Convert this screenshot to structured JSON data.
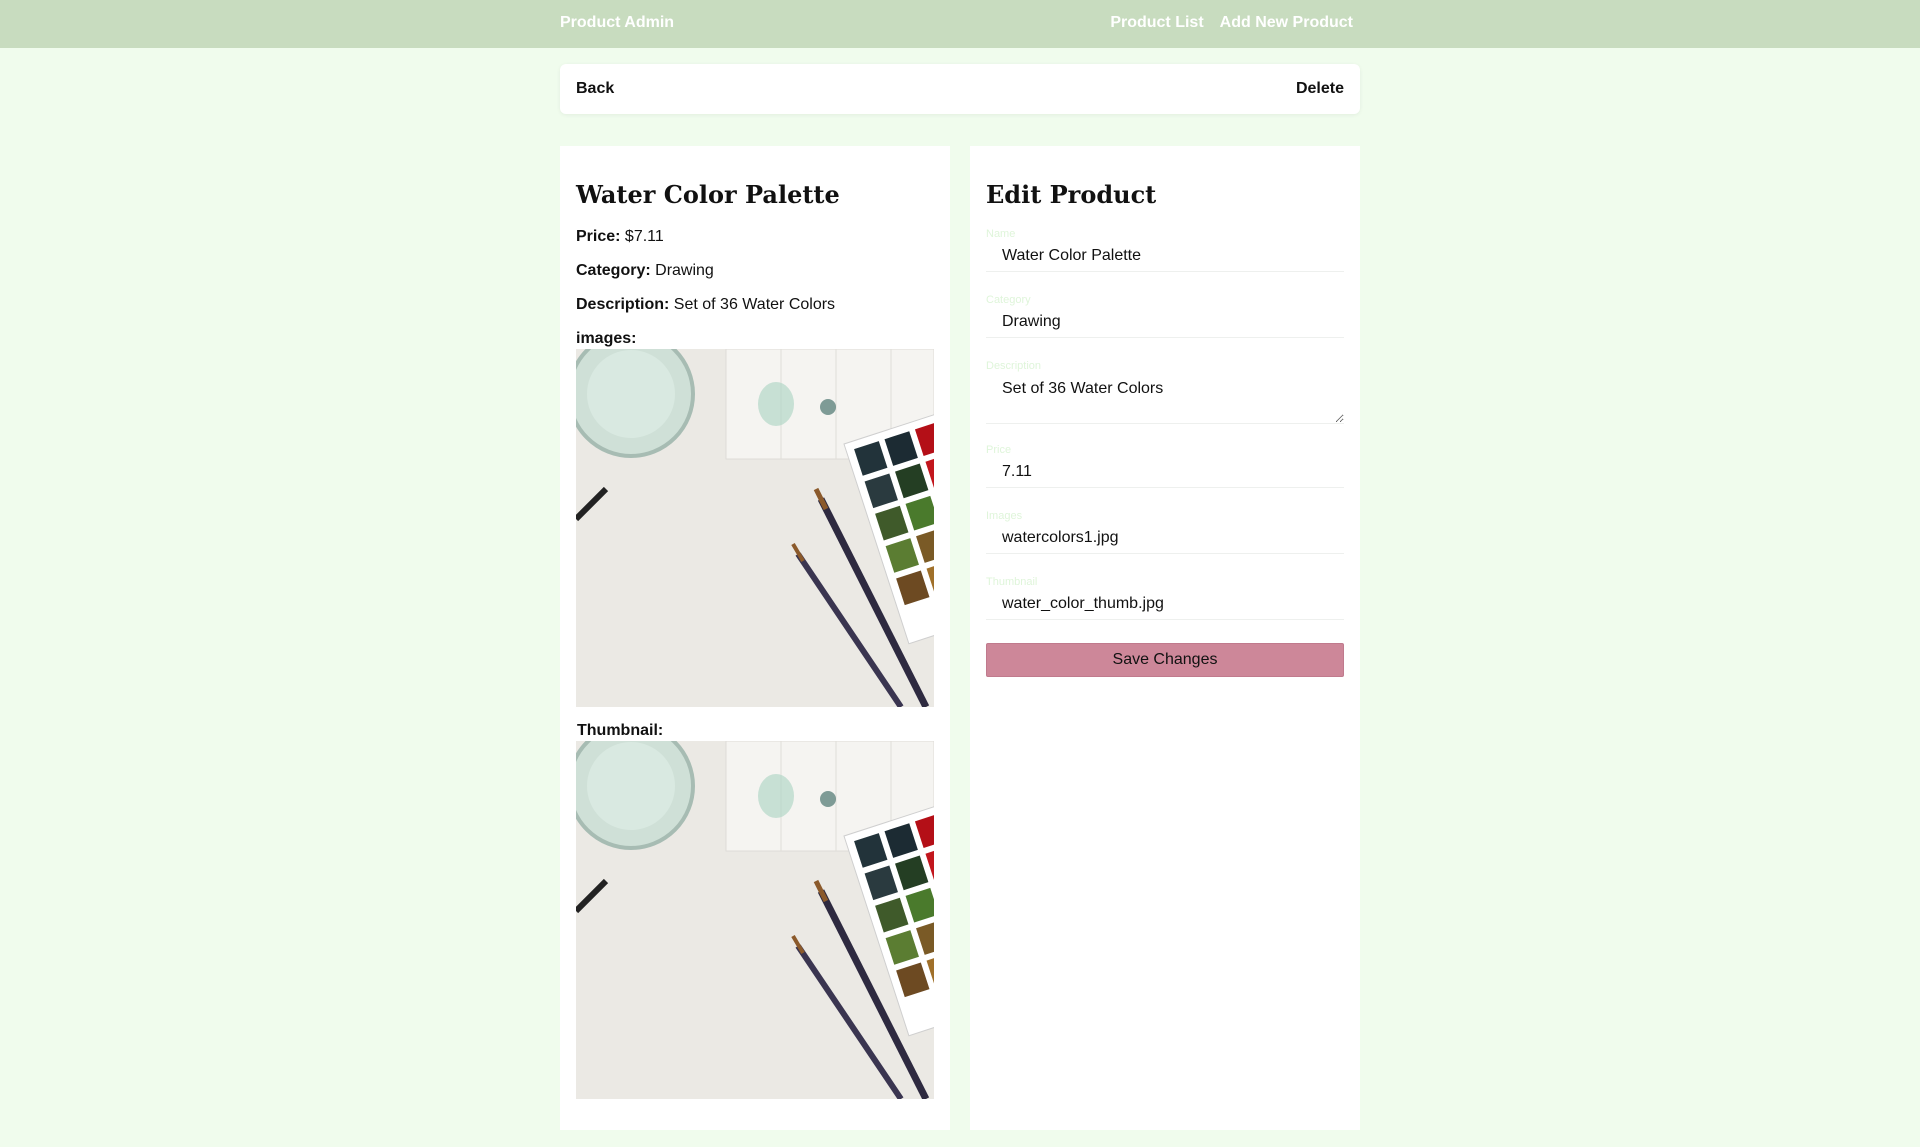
{
  "navbar": {
    "brand": "Product Admin",
    "links": [
      "Product List",
      "Add New Product"
    ]
  },
  "action_bar": {
    "back_label": "Back",
    "delete_label": "Delete"
  },
  "product": {
    "name": "Water Color Palette",
    "price_label": "Price:",
    "price_value": "$7.11",
    "category_label": "Category:",
    "category_value": "Drawing",
    "description_label": "Description:",
    "description_value": "Set of 36 Water Colors",
    "images_label": "images:",
    "thumbnail_label": "Thumbnail:"
  },
  "edit_form": {
    "title": "Edit Product",
    "fields": {
      "name": {
        "label": "Name",
        "value": "Water Color Palette"
      },
      "category": {
        "label": "Category",
        "value": "Drawing"
      },
      "description": {
        "label": "Description",
        "value": "Set of 36 Water Colors"
      },
      "price": {
        "label": "Price",
        "value": "7.11"
      },
      "images": {
        "label": "Images",
        "value": "watercolors1.jpg"
      },
      "thumbnail": {
        "label": "Thumbnail",
        "value": "water_color_thumb.jpg"
      }
    },
    "save_label": "Save Changes"
  },
  "colors": {
    "background": "#f0fced",
    "navbar": "#c8dcbf",
    "save_button": "#cd8799"
  }
}
